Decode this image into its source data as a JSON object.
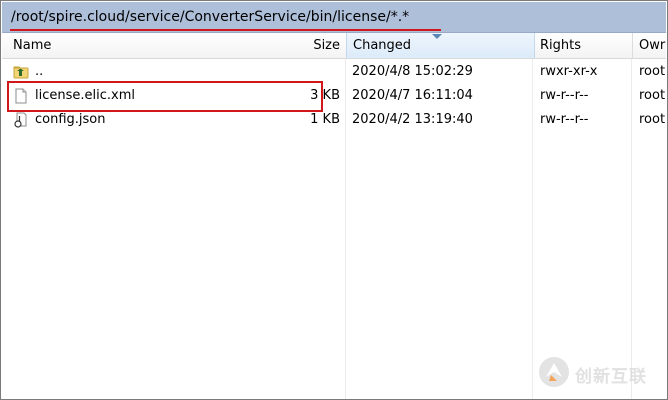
{
  "path": "/root/spire.cloud/service/ConverterService/bin/license/*.*",
  "columns": {
    "name": "Name",
    "size": "Size",
    "changed": "Changed",
    "rights": "Rights",
    "owner": "Owr"
  },
  "files": [
    {
      "name": "..",
      "size": "",
      "changed": "2020/4/8 15:02:29",
      "rights": "rwxr-xr-x",
      "owner": "root",
      "icon": "parent-folder-icon"
    },
    {
      "name": "license.elic.xml",
      "size": "3 KB",
      "changed": "2020/4/7 16:11:04",
      "rights": "rw-r--r--",
      "owner": "root",
      "icon": "file-icon"
    },
    {
      "name": "config.json",
      "size": "1 KB",
      "changed": "2020/4/2 13:19:40",
      "rights": "rw-r--r--",
      "owner": "root",
      "icon": "json-file-icon"
    }
  ],
  "watermark": "创新互联",
  "colors": {
    "path_bar": "#aebfd9",
    "highlight": "#d0181c",
    "sorted_header": "#dcebfa"
  }
}
